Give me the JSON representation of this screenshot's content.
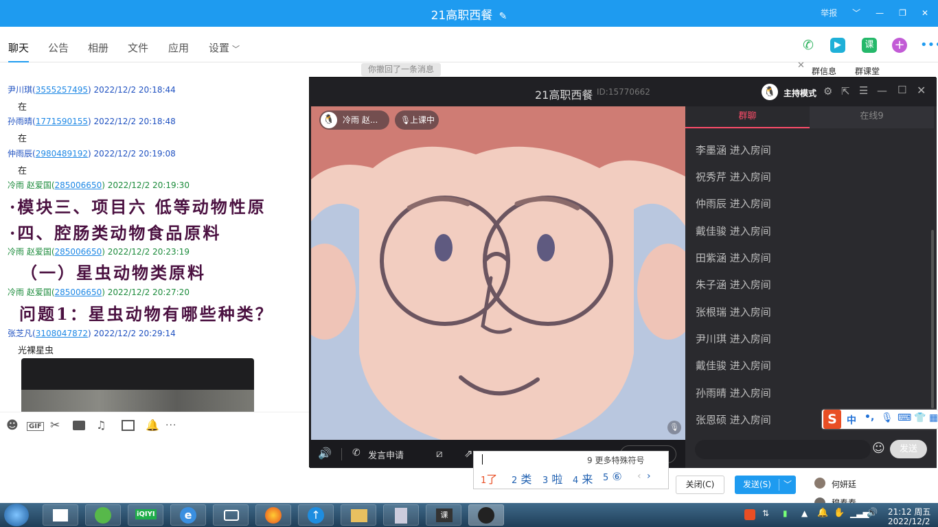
{
  "window": {
    "title": "21高职西餐",
    "report": "举报",
    "chevron": "﹀",
    "minimize": "—",
    "restore": "❐",
    "close": "✕"
  },
  "tabs": [
    "聊天",
    "公告",
    "相册",
    "文件",
    "应用",
    "设置"
  ],
  "header_tools": {
    "ke_label": "课"
  },
  "chat": {
    "recall_notice": "你撤回了一条消息",
    "messages": [
      {
        "name": "尹川琪(",
        "qq": "3555257495",
        "time": ") 2022/12/2 20:18:44",
        "text": "在"
      },
      {
        "name": "孙雨晴(",
        "qq": "1771590155",
        "time": ") 2022/12/2 20:18:48",
        "text": "在"
      },
      {
        "name": "仲雨辰(",
        "qq": "2980489192",
        "time": ") 2022/12/2 20:19:08",
        "text": "在"
      },
      {
        "name": "冷雨    赵爱国(",
        "qq": "285006650",
        "time": ") 2022/12/2 20:19:30"
      },
      {
        "name": "冷雨    赵爱国(",
        "qq": "285006650",
        "time": ") 2022/12/2 20:23:19"
      },
      {
        "name": "冷雨    赵爱国(",
        "qq": "285006650",
        "time": ") 2022/12/2 20:27:20"
      },
      {
        "name": "张芝凡(",
        "qq": "3108047872",
        "time": ") 2022/12/2 20:29:14",
        "text": "光裸星虫"
      }
    ],
    "slides": {
      "line1": "·模块三、项目六  低等动物性原",
      "line2": "·四、腔肠类动物食品原料",
      "line3": "（一）星虫动物类原料",
      "line4": "问题1：星虫动物有哪些种类？"
    },
    "toolbar_more": "···"
  },
  "group_side": {
    "info": "群信息",
    "classroom": "群课堂",
    "close_x": "✕",
    "members": [
      "何妍廷",
      "穆奉春"
    ]
  },
  "video": {
    "title": "21高职西餐",
    "id": "ID:15770662",
    "host_mode": "主持模式",
    "presenter": "冷雨   赵...",
    "status": "上课中",
    "speak_request": "发言申请",
    "tabs": {
      "group_chat": "群聊",
      "online": "在线9"
    },
    "entries": [
      "李墨涵 进入房间",
      "祝秀芹 进入房间",
      "仲雨辰 进入房间",
      "戴佳骏 进入房间",
      "田紫涵 进入房间",
      "朱子涵 进入房间",
      "张根瑞 进入房间",
      "尹川琪 进入房间",
      "戴佳骏 进入房间",
      "孙雨晴 进入房间",
      "张恩硕 进入房间"
    ],
    "send": "发送"
  },
  "ime": {
    "hint": "9 更多特殊符号",
    "candidates": [
      {
        "n": "1",
        "w": "了"
      },
      {
        "n": "2",
        "w": "类"
      },
      {
        "n": "3",
        "w": "啦"
      },
      {
        "n": "4",
        "w": "来"
      },
      {
        "n": "5",
        "w": "⑥"
      }
    ],
    "toolbar": {
      "logo": "S",
      "lang": "中",
      "punct": "•,"
    }
  },
  "buttons": {
    "close": "关闭(C)",
    "send": "发送(S)"
  },
  "taskbar": {
    "time": "21:12 周五",
    "date": "2022/12/2",
    "iqiyi": "iQIYI",
    "ke_icon": "课"
  },
  "colors": {
    "accent": "#1e9bf0",
    "dark": "#1f1f23",
    "red": "#ff4d6a"
  }
}
